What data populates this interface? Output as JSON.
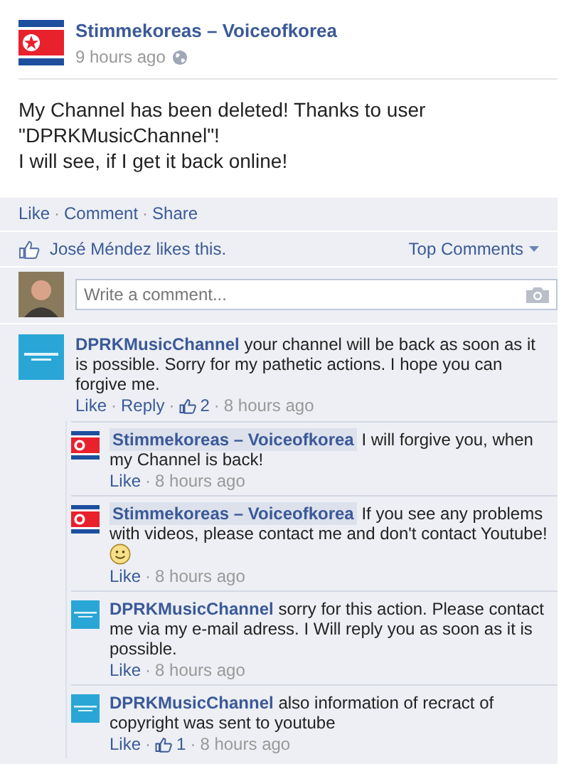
{
  "post": {
    "author": "Stimmekoreas – Voiceofkorea",
    "time": "9 hours ago",
    "text": [
      "My Channel has been deleted! Thanks to user",
      "\"DPRKMusicChannel\"!",
      "I will see, if I get it back online!"
    ]
  },
  "actions": [
    "Like",
    "Comment",
    "Share"
  ],
  "separator": "·",
  "likes": {
    "text": "José Méndez likes this.",
    "sort": "Top Comments"
  },
  "composer": {
    "placeholder": "Write a comment..."
  },
  "comments": [
    {
      "kind": "channel",
      "author": "DPRKMusicChannel",
      "highlighted": false,
      "text": "your channel will be back as soon as it is possible. Sorry for my pathetic actions. I hope you can forgive me.",
      "emoticon": false,
      "links": [
        "Like",
        "Reply"
      ],
      "like_count": "2",
      "time": "8 hours ago",
      "replies": [
        {
          "kind": "flag",
          "author": "Stimmekoreas – Voiceofkorea",
          "highlighted": true,
          "text": "I will forgive you, when my Channel is back!",
          "emoticon": false,
          "links": [
            "Like"
          ],
          "time": "8 hours ago"
        },
        {
          "kind": "flag",
          "author": "Stimmekoreas – Voiceofkorea",
          "highlighted": true,
          "text": "If you see any problems with videos, please contact me and don't contact Youtube!",
          "emoticon": true,
          "links": [
            "Like"
          ],
          "time": "8 hours ago"
        },
        {
          "kind": "channel",
          "author": "DPRKMusicChannel",
          "highlighted": false,
          "text": "sorry for this action. Please contact me via my e-mail adress. I Will reply you as soon as it is possible.",
          "emoticon": false,
          "links": [
            "Like"
          ],
          "time": "8 hours ago"
        },
        {
          "kind": "channel",
          "author": "DPRKMusicChannel",
          "highlighted": false,
          "text": "also information of recract of copyright was sent to youtube",
          "emoticon": false,
          "links": [
            "Like"
          ],
          "like_count": "1",
          "time": "8 hours ago"
        }
      ]
    }
  ]
}
